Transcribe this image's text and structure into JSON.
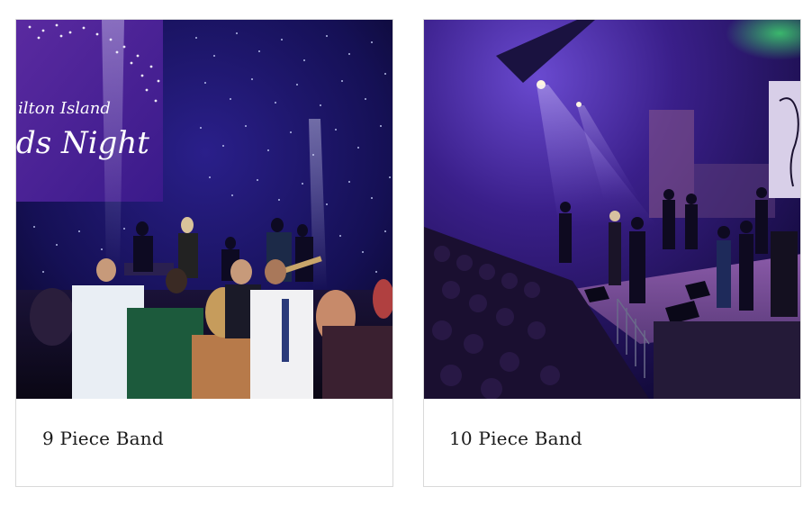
{
  "cards": [
    {
      "title": "9 Piece Band",
      "photo": {
        "screen_text_line1": "ilton Island",
        "screen_text_line2": "ds Night"
      }
    },
    {
      "title": "10 Piece Band"
    }
  ],
  "colors": {
    "caption_text": "#1a1a1a",
    "border": "#d9d9d9",
    "stage_purple": "#3a1a7a",
    "deep_blue": "#120a3a"
  }
}
